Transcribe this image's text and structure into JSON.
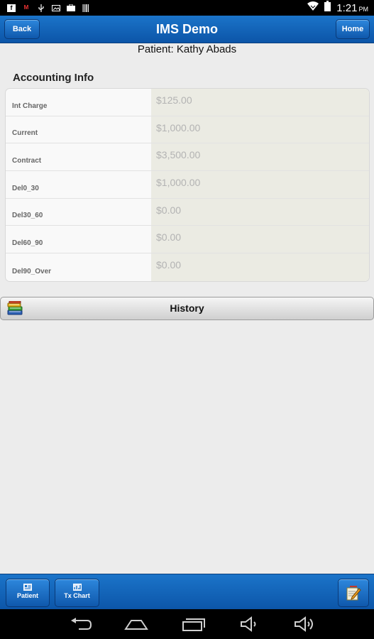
{
  "status_bar": {
    "time": "1:21",
    "ampm": "PM"
  },
  "header": {
    "back_label": "Back",
    "title": "IMS Demo",
    "home_label": "Home"
  },
  "patient_line": "Patient: Kathy Abads",
  "accounting": {
    "section_title": "Accounting Info",
    "rows": [
      {
        "label": "Int Charge",
        "value": "$125.00"
      },
      {
        "label": "Current",
        "value": "$1,000.00"
      },
      {
        "label": "Contract",
        "value": "$3,500.00"
      },
      {
        "label": "Del0_30",
        "value": "$1,000.00"
      },
      {
        "label": "Del30_60",
        "value": "$0.00"
      },
      {
        "label": "Del60_90",
        "value": "$0.00"
      },
      {
        "label": "Del90_Over",
        "value": "$0.00"
      }
    ]
  },
  "history": {
    "label": "History",
    "icon": "books-icon"
  },
  "footer": {
    "patient_label": "Patient",
    "tx_chart_label": "Tx Chart",
    "note_icon": "notepad-pencil-icon"
  },
  "colors": {
    "header_blue": "#0c55a8",
    "button_blue": "#1b74c9",
    "value_bg": "#ebebe3"
  }
}
